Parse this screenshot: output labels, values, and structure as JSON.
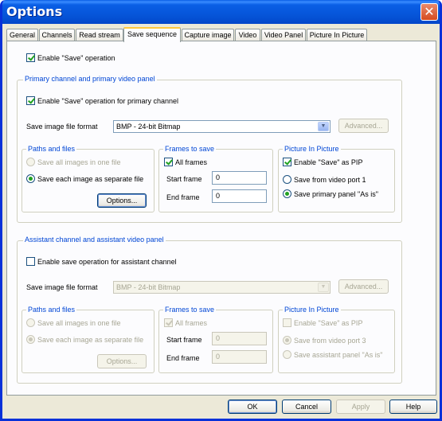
{
  "window": {
    "title": "Options",
    "close_glyph": "✕"
  },
  "tabs": [
    "General",
    "Channels",
    "Read stream",
    "Save sequence",
    "Capture image",
    "Video",
    "Video Panel",
    "Picture In Picture"
  ],
  "active_tab": "Save sequence",
  "enable_save": {
    "label": "Enable \"Save\" operation",
    "checked": true
  },
  "primary": {
    "group_title": "Primary channel and primary video panel",
    "enable_label": "Enable \"Save\" operation for primary channel",
    "enable_checked": true,
    "format_label": "Save image file format",
    "format_value": "BMP - 24-bit Bitmap",
    "advanced_label": "Advanced...",
    "paths": {
      "title": "Paths and files",
      "save_all": "Save all  images in one file",
      "save_each": "Save each image as separate file",
      "selected": "save_each",
      "options_label": "Options..."
    },
    "frames": {
      "title": "Frames to save",
      "all_frames": "All frames",
      "all_checked": true,
      "start_label": "Start frame",
      "start_value": "0",
      "end_label": "End frame",
      "end_value": "0"
    },
    "pip": {
      "title": "Picture In Picture",
      "enable_label": "Enable \"Save\" as PIP",
      "enable_checked": true,
      "from_port": "Save from video port 1",
      "panel_as_is": "Save primary panel \"As is\"",
      "selected": "panel_as_is"
    }
  },
  "assistant": {
    "group_title": "Assistant channel and assistant video panel",
    "enable_label": "Enable save operation for assistant channel",
    "enable_checked": false,
    "format_label": "Save image file format",
    "format_value": "BMP - 24-bit Bitmap",
    "advanced_label": "Advanced...",
    "paths": {
      "title": "Paths and files",
      "save_all": "Save all  images in one file",
      "save_each": "Save each image as separate file",
      "selected": "save_each",
      "options_label": "Options..."
    },
    "frames": {
      "title": "Frames to save",
      "all_frames": "All frames",
      "all_checked": true,
      "start_label": "Start frame",
      "start_value": "0",
      "end_label": "End frame",
      "end_value": "0"
    },
    "pip": {
      "title": "Picture In Picture",
      "enable_label": "Enable \"Save\" as PIP",
      "enable_checked": false,
      "from_port": "Save from video port 3",
      "panel_as_is": "Save assistant panel \"As is\"",
      "selected": "from_port"
    }
  },
  "buttons": {
    "ok": "OK",
    "cancel": "Cancel",
    "apply": "Apply",
    "help": "Help"
  }
}
